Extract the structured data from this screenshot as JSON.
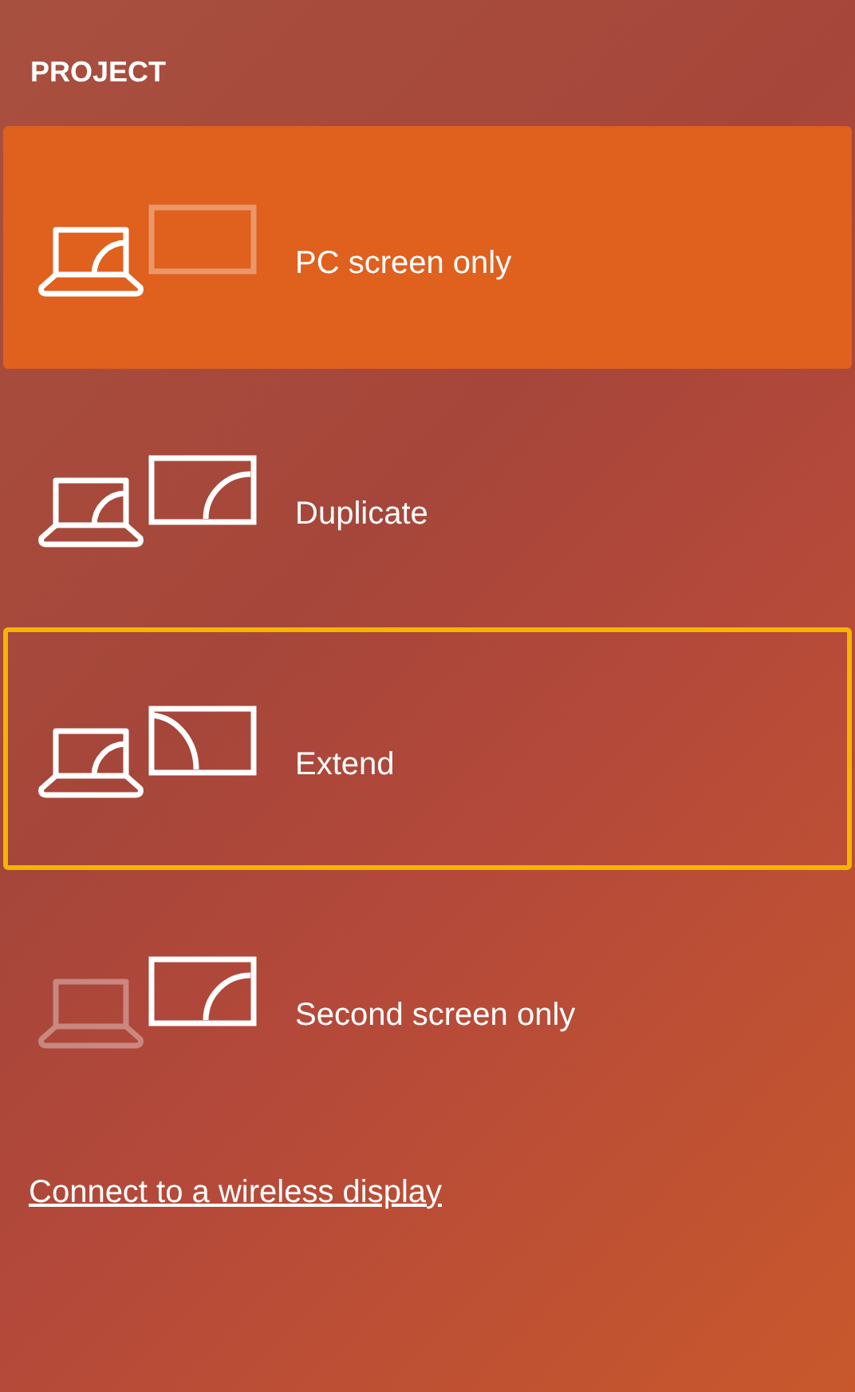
{
  "title": "PROJECT",
  "options": [
    {
      "kind": "pc_only",
      "label": "PC screen only",
      "selected": true,
      "focused": false
    },
    {
      "kind": "duplicate",
      "label": "Duplicate",
      "selected": false,
      "focused": false
    },
    {
      "kind": "extend",
      "label": "Extend",
      "selected": false,
      "focused": true
    },
    {
      "kind": "second_only",
      "label": "Second screen only",
      "selected": false,
      "focused": false
    }
  ],
  "link": "Connect to a wireless display"
}
